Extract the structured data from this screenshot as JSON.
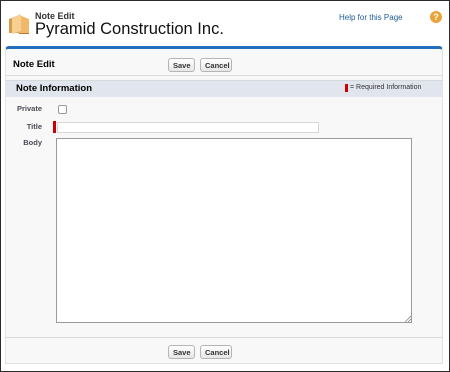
{
  "header": {
    "page_type": "Note Edit",
    "title": "Pyramid Construction Inc.",
    "help_link": "Help for this Page",
    "help_icon": "?"
  },
  "panel": {
    "title": "Note Edit",
    "save_label": "Save",
    "cancel_label": "Cancel"
  },
  "section": {
    "title": "Note Information",
    "required_legend": "= Required Information"
  },
  "fields": {
    "private_label": "Private",
    "private_checked": false,
    "title_label": "Title",
    "title_value": "",
    "body_label": "Body",
    "body_value": ""
  },
  "colors": {
    "accent": "#236fbd",
    "required": "#cc0000",
    "section_bg": "#e1e5ed",
    "help_icon": "#e8a33a"
  },
  "icons": {
    "page_icon": "folder-notes-icon",
    "help_icon": "help-question-icon",
    "resize_icon": "resize-grip-icon"
  }
}
